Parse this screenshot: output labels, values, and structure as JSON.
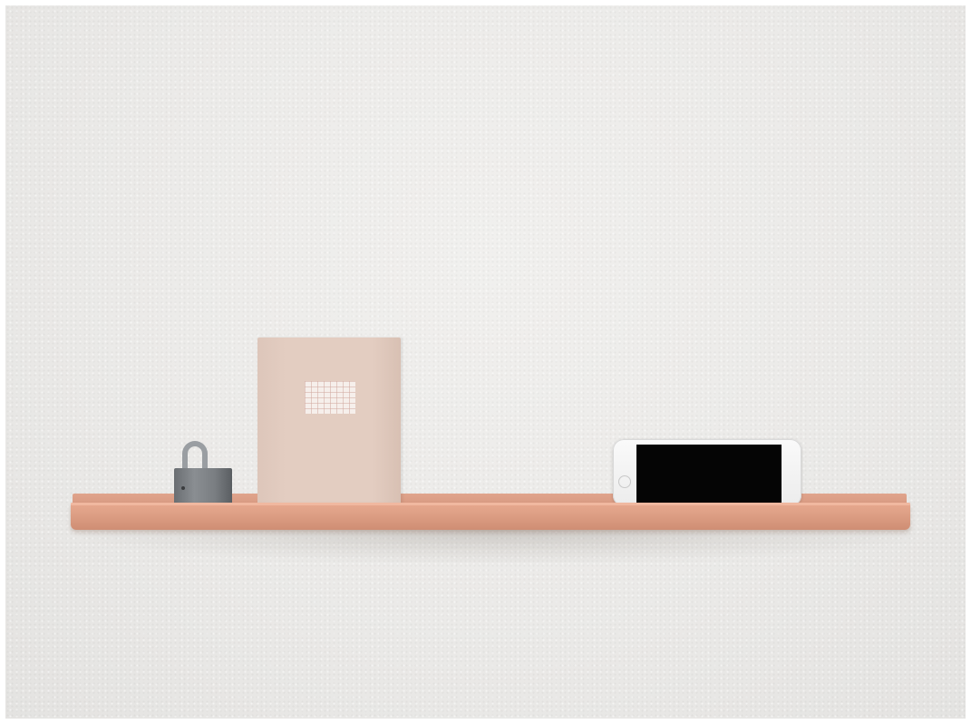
{
  "scene": {
    "subject": "wall-shelf",
    "colors": {
      "wall": "#ebeae8",
      "shelf": "#dea086",
      "notebook": "#e3cdc1",
      "padlock": "#7a7e82",
      "phone_body": "#f4f4f4",
      "phone_screen": "#050505"
    },
    "objects": [
      "padlock",
      "notebook",
      "smartphone"
    ]
  }
}
